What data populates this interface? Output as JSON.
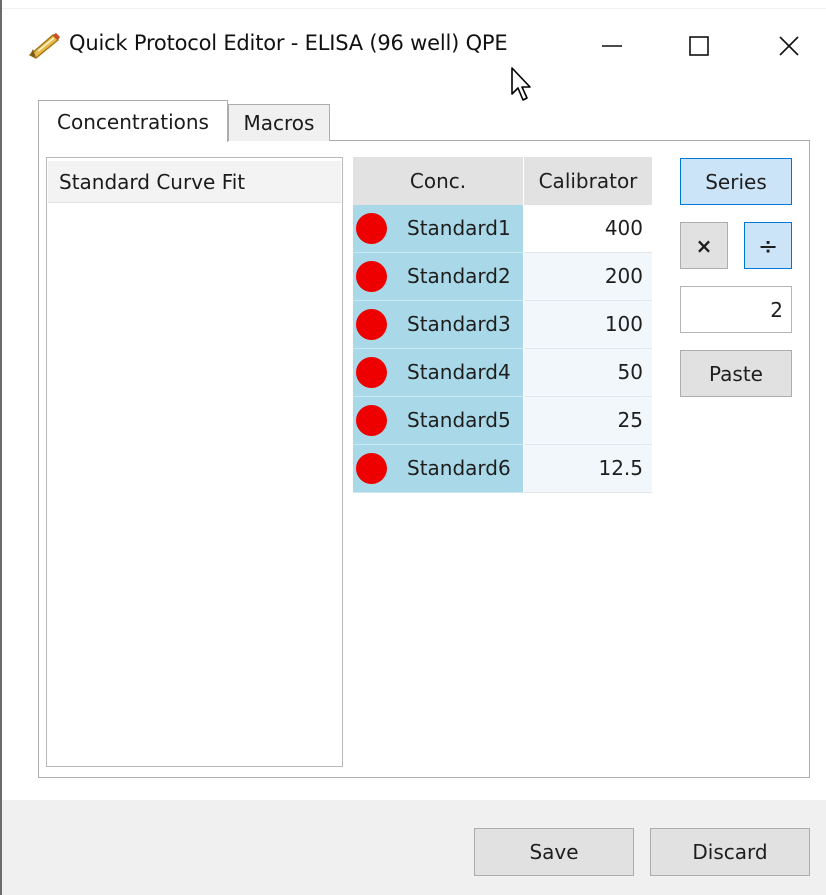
{
  "window": {
    "title": "Quick Protocol Editor - ELISA (96 well) QPE",
    "icons": {
      "app": "pencil-icon",
      "minimize": "minimize-icon",
      "maximize": "maximize-icon",
      "close": "close-icon"
    }
  },
  "tabs": [
    {
      "label": "Concentrations",
      "active": true
    },
    {
      "label": "Macros",
      "active": false
    }
  ],
  "left_list": {
    "items": [
      {
        "label": "Standard Curve Fit"
      }
    ]
  },
  "grid": {
    "headers": {
      "conc": "Conc.",
      "calibrator": "Calibrator"
    },
    "rows": [
      {
        "name": "Standard1",
        "value": "400",
        "marker_color": "#ee0000"
      },
      {
        "name": "Standard2",
        "value": "200",
        "marker_color": "#ee0000"
      },
      {
        "name": "Standard3",
        "value": "100",
        "marker_color": "#ee0000"
      },
      {
        "name": "Standard4",
        "value": "50",
        "marker_color": "#ee0000"
      },
      {
        "name": "Standard5",
        "value": "25",
        "marker_color": "#ee0000"
      },
      {
        "name": "Standard6",
        "value": "12.5",
        "marker_color": "#ee0000"
      }
    ]
  },
  "controls": {
    "series_label": "Series",
    "multiply_label": "×",
    "divide_label": "÷",
    "factor_value": "2",
    "paste_label": "Paste"
  },
  "footer": {
    "save_label": "Save",
    "discard_label": "Discard"
  },
  "colors": {
    "accent_border": "#0078d7",
    "accent_fill": "#cce4f7",
    "row_name_bg": "#a9d9e8",
    "marker": "#ee0000"
  }
}
